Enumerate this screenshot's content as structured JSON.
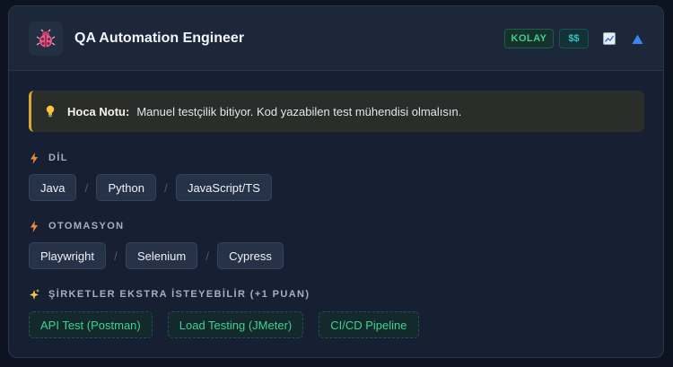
{
  "card": {
    "title": "QA Automation Engineer",
    "icon": "ladybug-bug-icon",
    "difficulty": "KOLAY",
    "cost": "$$",
    "actions": [
      "chart-icon",
      "triangle-up-icon"
    ]
  },
  "note": {
    "icon": "lightbulb-icon",
    "label": "Hoca Notu:",
    "text": "Manuel testçilik bitiyor. Kod yazabilen test mühendisi olmalısın."
  },
  "sections": [
    {
      "title": "DİL",
      "icon": "lightning-icon",
      "separator": "/",
      "items": [
        "Java",
        "Python",
        "JavaScript/TS"
      ]
    },
    {
      "title": "OTOMASYON",
      "icon": "lightning-icon",
      "separator": "/",
      "items": [
        "Playwright",
        "Selenium",
        "Cypress"
      ]
    },
    {
      "title": "ŞİRKETLER EKSTRA İSTEYEBİLİR (+1 PUAN)",
      "icon": "sparkles-icon",
      "items": [
        "API Test (Postman)",
        "Load Testing (JMeter)",
        "CI/CD Pipeline"
      ]
    }
  ],
  "colors": {
    "background": "#0d1320",
    "card": "#172033",
    "header": "#1c2739",
    "note_accent": "#d8a731",
    "badge_green": "#3fd08a",
    "badge_teal": "#37c2c7",
    "extra_green": "#3ed291"
  }
}
